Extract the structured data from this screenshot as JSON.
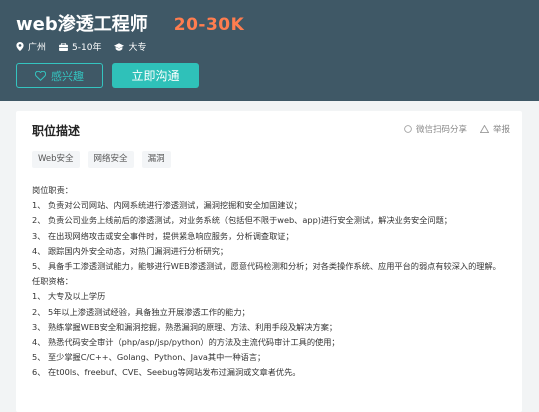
{
  "job": {
    "title": "web渗透工程师",
    "salary": "20-30K",
    "city": "广州",
    "experience": "5-10年",
    "education": "大专"
  },
  "actions": {
    "interest_label": "感兴趣",
    "chat_label": "立即沟通",
    "share_label": "微信扫码分享",
    "report_label": "举报"
  },
  "description": {
    "section_title": "职位描述",
    "tags": [
      "Web安全",
      "网络安全",
      "漏洞"
    ],
    "lines": [
      "岗位职责：",
      "1、 负责对公司网站、内网系统进行渗透测试，漏洞挖掘和安全加固建议；",
      "2、 负责公司业务上线前后的渗透测试，对业务系统（包括但不限于web、app)进行安全测试，解决业务安全问题；",
      "3、 在出现网络攻击或安全事件时，提供紧急响应服务，分析调查取证；",
      "4、 跟踪国内外安全动态，对热门漏洞进行分析研究；",
      "5、 具备手工渗透测试能力，能够进行WEB渗透测试，愿意代码检测和分析；对各类操作系统、应用平台的弱点有较深入的理解。",
      "任职资格：",
      "1、 大专及以上学历",
      "2、 5年以上渗透测试经验，具备独立开展渗透工作的能力；",
      "3、 熟练掌握WEB安全和漏洞挖掘，熟悉漏洞的原理、方法、利用手段及解决方案；",
      "4、 熟悉代码安全审计（php/asp/jsp/python）的方法及主流代码审计工具的使用；",
      "5、 至少掌握C/C++、Golang、Python、Java其中一种语言；",
      "6、 在t00ls、freebuf、CVE、Seebug等网站发布过漏洞或文章者优先。"
    ]
  }
}
